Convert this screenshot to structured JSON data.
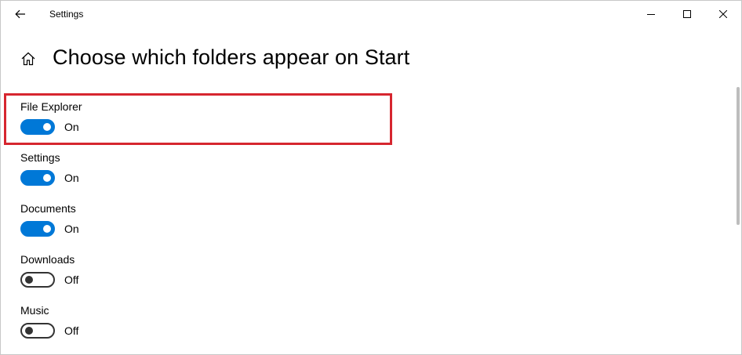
{
  "window": {
    "title": "Settings",
    "controls": {
      "back": "back-arrow-icon",
      "minimize": "minimize-icon",
      "maximize": "maximize-icon",
      "close": "close-icon"
    }
  },
  "header": {
    "home_icon": "home-icon",
    "title": "Choose which folders appear on Start"
  },
  "settings": [
    {
      "label": "File Explorer",
      "state": "On",
      "enabled": true,
      "highlighted": true
    },
    {
      "label": "Settings",
      "state": "On",
      "enabled": true
    },
    {
      "label": "Documents",
      "state": "On",
      "enabled": true
    },
    {
      "label": "Downloads",
      "state": "Off",
      "enabled": false
    },
    {
      "label": "Music",
      "state": "Off",
      "enabled": false
    }
  ],
  "colors": {
    "accent": "#0078d7",
    "highlight": "#d6262f",
    "toggle_off_border": "#333333"
  }
}
